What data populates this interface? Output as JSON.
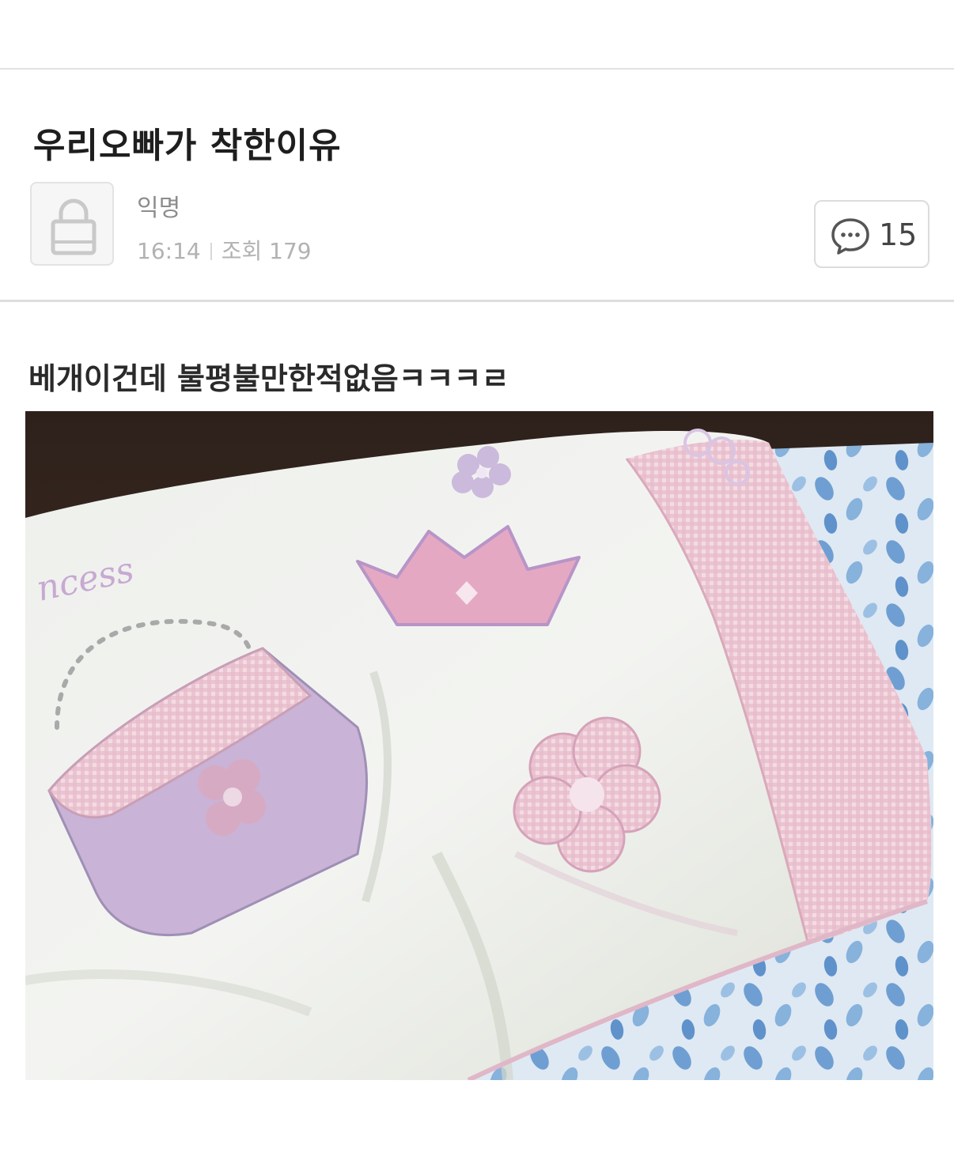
{
  "post": {
    "title": "우리오빠가 착한이유",
    "author": {
      "name": "익명",
      "avatar_icon": "lock-icon"
    },
    "time": "16:14",
    "views_label": "조회",
    "views_count": "179",
    "comment_icon": "speech-bubble-icon",
    "comment_count": "15",
    "body_text": "베개이건데 불평불만한적없음ㅋㅋㅋㄹ",
    "image_text": "ncess"
  },
  "colors": {
    "pillow_white": "#eceee9",
    "gingham_pink": "#e8c3cf",
    "crown_pink": "#e3a9c2",
    "purse_lavender": "#c9b3d6",
    "blanket_blue": "#7aa7d6",
    "background_dark": "#3a2a22"
  }
}
